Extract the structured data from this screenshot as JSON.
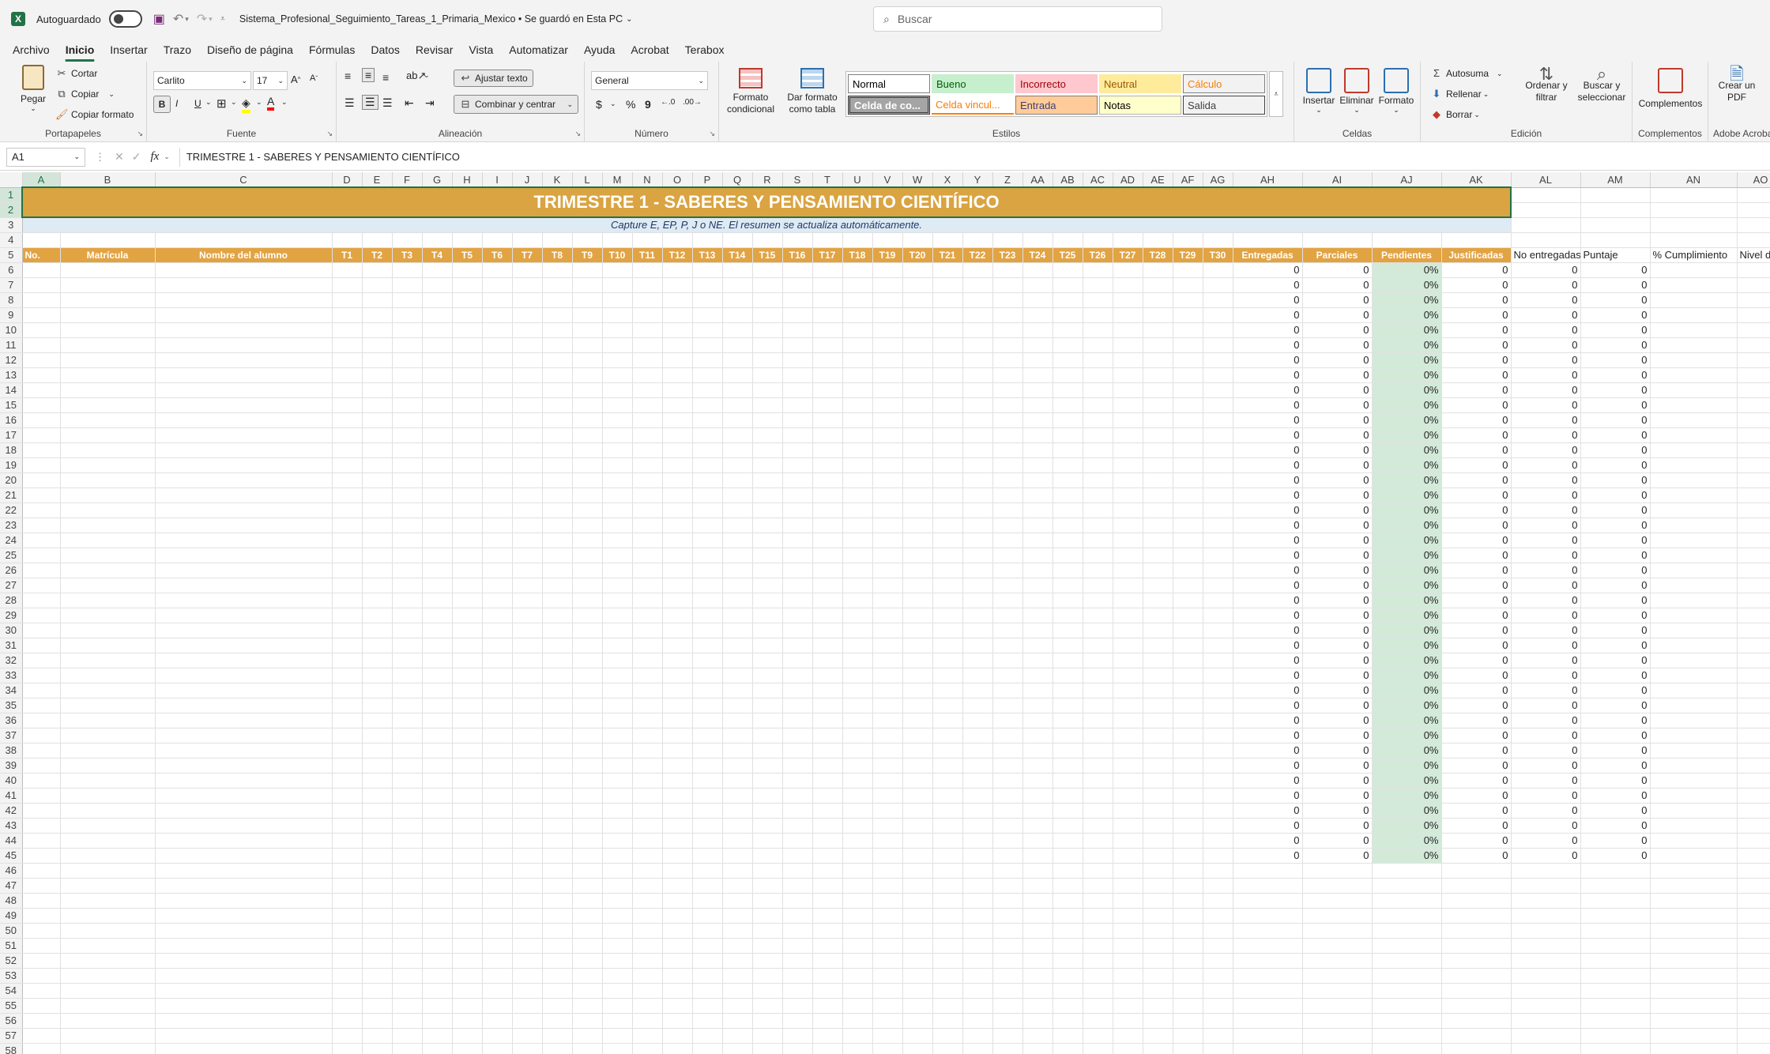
{
  "titlebar": {
    "autosave_label": "Autoguardado",
    "filename": "Sistema_Profesional_Seguimiento_Tareas_1_Primaria_Mexico • Se guardó en Esta PC",
    "search_placeholder": "Buscar"
  },
  "menu": [
    "Archivo",
    "Inicio",
    "Insertar",
    "Trazo",
    "Diseño de página",
    "Fórmulas",
    "Datos",
    "Revisar",
    "Vista",
    "Automatizar",
    "Ayuda",
    "Acrobat",
    "Terabox"
  ],
  "ribbon": {
    "clipboard": {
      "paste": "Pegar",
      "cut": "Cortar",
      "copy": "Copiar",
      "format_painter": "Copiar formato",
      "label": "Portapapeles"
    },
    "font": {
      "family": "Carlito",
      "size": "17",
      "bold": "B",
      "italic": "I",
      "underline": "U",
      "label": "Fuente"
    },
    "alignment": {
      "wrap": "Ajustar texto",
      "merge": "Combinar y centrar",
      "label": "Alineación"
    },
    "number": {
      "format": "General",
      "currency": "$",
      "percent": "%",
      "comma": "9",
      "label": "Número"
    },
    "styles": {
      "conditional": "Formato condicional",
      "as_table": "Dar formato como tabla",
      "label": "Estilos",
      "cells": [
        {
          "name": "Normal",
          "bg": "#ffffff",
          "fg": "#000000",
          "border": "#7f7f7f"
        },
        {
          "name": "Bueno",
          "bg": "#c6efce",
          "fg": "#006100",
          "border": "#c6efce"
        },
        {
          "name": "Incorrecto",
          "bg": "#ffc7ce",
          "fg": "#9c0006",
          "border": "#ffc7ce"
        },
        {
          "name": "Neutral",
          "bg": "#ffeb9c",
          "fg": "#9c5700",
          "border": "#ffeb9c"
        },
        {
          "name": "Cálculo",
          "bg": "#f2f2f2",
          "fg": "#fa7d00",
          "border": "#7f7f7f"
        },
        {
          "name": "Celda de co...",
          "bg": "#a5a5a5",
          "fg": "#ffffff",
          "border": "#3f3f3f"
        },
        {
          "name": "Celda vincul...",
          "bg": "#ffffff",
          "fg": "#fa7d00",
          "border": "#ff8001"
        },
        {
          "name": "Entrada",
          "bg": "#ffcc99",
          "fg": "#3f3f76",
          "border": "#7f7f7f"
        },
        {
          "name": "Notas",
          "bg": "#ffffcc",
          "fg": "#000000",
          "border": "#b2b2b2"
        },
        {
          "name": "Salida",
          "bg": "#f2f2f2",
          "fg": "#3f3f3f",
          "border": "#3f3f3f"
        }
      ]
    },
    "cells": {
      "insert": "Insertar",
      "delete": "Eliminar",
      "format": "Formato",
      "label": "Celdas"
    },
    "editing": {
      "autosum": "Autosuma",
      "fill": "Rellenar",
      "clear": "Borrar",
      "sort": "Ordenar y filtrar",
      "find": "Buscar y seleccionar",
      "label": "Edición"
    },
    "addins": {
      "addins": "Complementos",
      "label": "Complementos"
    },
    "acrobat": {
      "create": "Crear un PDF",
      "label": "Adobe Acrobat"
    }
  },
  "formula_bar": {
    "name_box": "A1",
    "fx": "fx",
    "formula": "TRIMESTRE 1 - SABERES Y PENSAMIENTO CIENTÍFICO"
  },
  "sheet": {
    "title": "TRIMESTRE 1 - SABERES Y PENSAMIENTO CIENTÍFICO",
    "subtitle": "Capture E, EP, P, J o NE. El resumen se actualiza automáticamente.",
    "headers": [
      "No.",
      "Matrícula",
      "Nombre del alumno",
      "T1",
      "T2",
      "T3",
      "T4",
      "T5",
      "T6",
      "T7",
      "T8",
      "T9",
      "T10",
      "T11",
      "T12",
      "T13",
      "T14",
      "T15",
      "T16",
      "T17",
      "T18",
      "T19",
      "T20",
      "T21",
      "T22",
      "T23",
      "T24",
      "T25",
      "T26",
      "T27",
      "T28",
      "T29",
      "T30",
      "Entregadas",
      "Parciales",
      "Pendientes",
      "Justificadas",
      "No entregadas",
      "Puntaje",
      "% Cumplimiento",
      "Nivel de desempeño"
    ],
    "summary_row": {
      "entregadas": "0",
      "parciales": "0",
      "pendientes": "0%",
      "justificadas": "0",
      "no_entregadas": "0",
      "puntaje": "0"
    },
    "data_row_count": 40,
    "first_data_row": 6,
    "last_row": 58
  },
  "colors": {
    "accent": "#217346",
    "header_orange": "#e2a342",
    "title_bg": "#d9a441",
    "pending_green": "#d3ead9",
    "subtitle_bg": "#deeaf4"
  }
}
